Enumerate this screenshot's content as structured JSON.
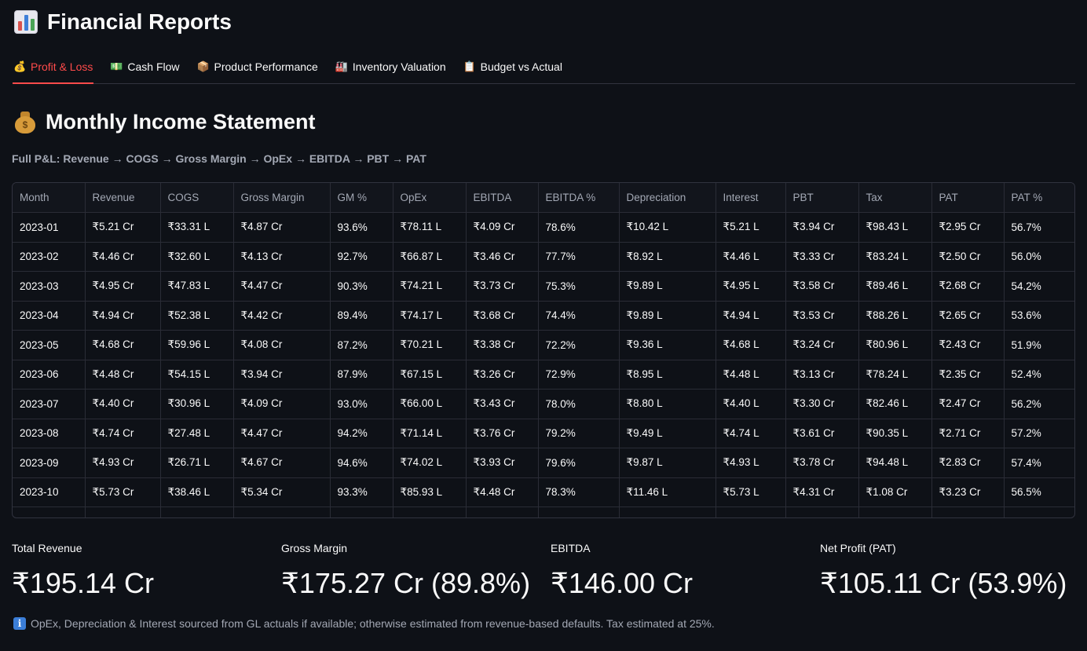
{
  "page": {
    "title": "Financial Reports",
    "title_icon": "bar-chart-icon"
  },
  "tabs": [
    {
      "label": "Profit & Loss",
      "icon": "money-bag-icon",
      "glyph": "💰",
      "active": true
    },
    {
      "label": "Cash Flow",
      "icon": "banknote-icon",
      "glyph": "💵",
      "active": false
    },
    {
      "label": "Product Performance",
      "icon": "package-icon",
      "glyph": "📦",
      "active": false
    },
    {
      "label": "Inventory Valuation",
      "icon": "factory-icon",
      "glyph": "🏭",
      "active": false
    },
    {
      "label": "Budget vs Actual",
      "icon": "clipboard-icon",
      "glyph": "📋",
      "active": false
    }
  ],
  "section": {
    "title": "Monthly Income Statement",
    "icon": "money-bag-icon",
    "caption": "Full P&L: Revenue → COGS → Gross Margin → OpEx → EBITDA → PBT → PAT"
  },
  "table": {
    "columns": [
      "Month",
      "Revenue",
      "COGS",
      "Gross Margin",
      "GM %",
      "OpEx",
      "EBITDA",
      "EBITDA %",
      "Depreciation",
      "Interest",
      "PBT",
      "Tax",
      "PAT",
      "PAT %"
    ],
    "rows": [
      [
        "2023-01",
        "₹5.21 Cr",
        "₹33.31 L",
        "₹4.87 Cr",
        "93.6%",
        "₹78.11 L",
        "₹4.09 Cr",
        "78.6%",
        "₹10.42 L",
        "₹5.21 L",
        "₹3.94 Cr",
        "₹98.43 L",
        "₹2.95 Cr",
        "56.7%"
      ],
      [
        "2023-02",
        "₹4.46 Cr",
        "₹32.60 L",
        "₹4.13 Cr",
        "92.7%",
        "₹66.87 L",
        "₹3.46 Cr",
        "77.7%",
        "₹8.92 L",
        "₹4.46 L",
        "₹3.33 Cr",
        "₹83.24 L",
        "₹2.50 Cr",
        "56.0%"
      ],
      [
        "2023-03",
        "₹4.95 Cr",
        "₹47.83 L",
        "₹4.47 Cr",
        "90.3%",
        "₹74.21 L",
        "₹3.73 Cr",
        "75.3%",
        "₹9.89 L",
        "₹4.95 L",
        "₹3.58 Cr",
        "₹89.46 L",
        "₹2.68 Cr",
        "54.2%"
      ],
      [
        "2023-04",
        "₹4.94 Cr",
        "₹52.38 L",
        "₹4.42 Cr",
        "89.4%",
        "₹74.17 L",
        "₹3.68 Cr",
        "74.4%",
        "₹9.89 L",
        "₹4.94 L",
        "₹3.53 Cr",
        "₹88.26 L",
        "₹2.65 Cr",
        "53.6%"
      ],
      [
        "2023-05",
        "₹4.68 Cr",
        "₹59.96 L",
        "₹4.08 Cr",
        "87.2%",
        "₹70.21 L",
        "₹3.38 Cr",
        "72.2%",
        "₹9.36 L",
        "₹4.68 L",
        "₹3.24 Cr",
        "₹80.96 L",
        "₹2.43 Cr",
        "51.9%"
      ],
      [
        "2023-06",
        "₹4.48 Cr",
        "₹54.15 L",
        "₹3.94 Cr",
        "87.9%",
        "₹67.15 L",
        "₹3.26 Cr",
        "72.9%",
        "₹8.95 L",
        "₹4.48 L",
        "₹3.13 Cr",
        "₹78.24 L",
        "₹2.35 Cr",
        "52.4%"
      ],
      [
        "2023-07",
        "₹4.40 Cr",
        "₹30.96 L",
        "₹4.09 Cr",
        "93.0%",
        "₹66.00 L",
        "₹3.43 Cr",
        "78.0%",
        "₹8.80 L",
        "₹4.40 L",
        "₹3.30 Cr",
        "₹82.46 L",
        "₹2.47 Cr",
        "56.2%"
      ],
      [
        "2023-08",
        "₹4.74 Cr",
        "₹27.48 L",
        "₹4.47 Cr",
        "94.2%",
        "₹71.14 L",
        "₹3.76 Cr",
        "79.2%",
        "₹9.49 L",
        "₹4.74 L",
        "₹3.61 Cr",
        "₹90.35 L",
        "₹2.71 Cr",
        "57.2%"
      ],
      [
        "2023-09",
        "₹4.93 Cr",
        "₹26.71 L",
        "₹4.67 Cr",
        "94.6%",
        "₹74.02 L",
        "₹3.93 Cr",
        "79.6%",
        "₹9.87 L",
        "₹4.93 L",
        "₹3.78 Cr",
        "₹94.48 L",
        "₹2.83 Cr",
        "57.4%"
      ],
      [
        "2023-10",
        "₹5.73 Cr",
        "₹38.46 L",
        "₹5.34 Cr",
        "93.3%",
        "₹85.93 L",
        "₹4.48 Cr",
        "78.3%",
        "₹11.46 L",
        "₹5.73 L",
        "₹4.31 Cr",
        "₹1.08 Cr",
        "₹3.23 Cr",
        "56.5%"
      ],
      [
        "",
        "",
        "",
        "",
        "",
        "",
        "",
        "",
        "",
        "",
        "",
        "",
        "",
        ""
      ]
    ]
  },
  "metrics": [
    {
      "label": "Total Revenue",
      "value": "₹195.14 Cr"
    },
    {
      "label": "Gross Margin",
      "value": "₹175.27 Cr (89.8%)"
    },
    {
      "label": "EBITDA",
      "value": "₹146.00 Cr"
    },
    {
      "label": "Net Profit (PAT)",
      "value": "₹105.11 Cr (53.9%)"
    }
  ],
  "footnote": {
    "icon": "info-icon",
    "text": "OpEx, Depreciation & Interest sourced from GL actuals if available; otherwise estimated from revenue-based defaults. Tax estimated at 25%."
  },
  "colors": {
    "background": "#0e1117",
    "accent": "#ff4b4b",
    "muted_text": "#a3a8b4",
    "border": "#31333f"
  }
}
